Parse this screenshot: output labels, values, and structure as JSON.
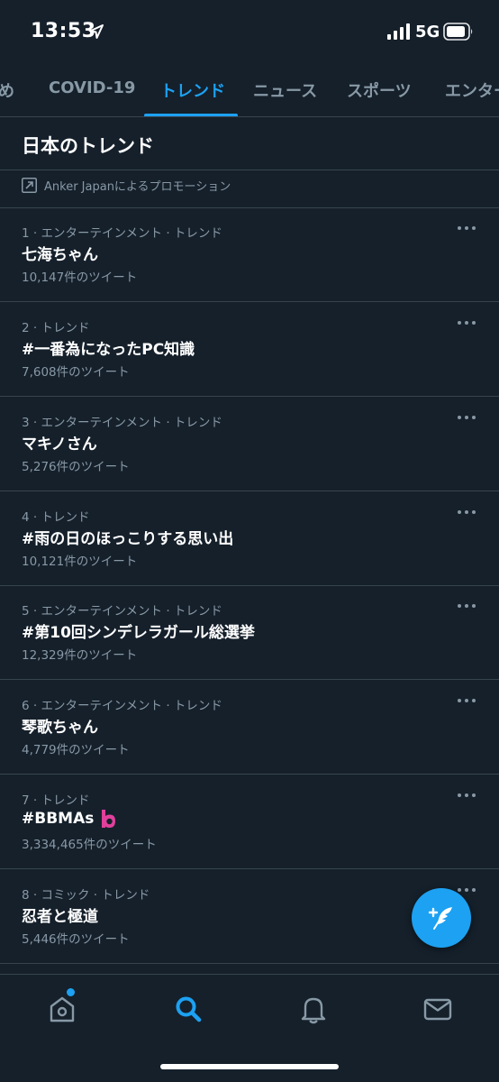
{
  "status_bar": {
    "time": "13:53",
    "network": "5G"
  },
  "tabs": [
    {
      "label": "め",
      "active": false
    },
    {
      "label": "COVID-19",
      "active": false
    },
    {
      "label": "トレンド",
      "active": true
    },
    {
      "label": "ニュース",
      "active": false
    },
    {
      "label": "スポーツ",
      "active": false
    },
    {
      "label": "エンター",
      "active": false
    }
  ],
  "section_title": "日本のトレンド",
  "promotion": {
    "text": "Anker Japanによるプロモーション"
  },
  "trends": [
    {
      "meta": "1 · エンターテインメント · トレンド",
      "name": "七海ちゃん",
      "count": "10,147件のツイート"
    },
    {
      "meta": "2 · トレンド",
      "name": "#一番為になったPC知識",
      "count": "7,608件のツイート"
    },
    {
      "meta": "3 · エンターテインメント · トレンド",
      "name": "マキノさん",
      "count": "5,276件のツイート"
    },
    {
      "meta": "4 · トレンド",
      "name": "#雨の日のほっこりする思い出",
      "count": "10,121件のツイート"
    },
    {
      "meta": "5 · エンターテインメント · トレンド",
      "name": "#第10回シンデレラガール総選挙",
      "count": "12,329件のツイート"
    },
    {
      "meta": "6 · エンターテインメント · トレンド",
      "name": "琴歌ちゃん",
      "count": "4,779件のツイート"
    },
    {
      "meta": "7 · トレンド",
      "name": "#BBMAs",
      "count": "3,334,465件のツイート"
    },
    {
      "meta": "8 · コミック · トレンド",
      "name": "忍者と極道",
      "count": "5,446件のツイート"
    }
  ],
  "bottom_nav": [
    {
      "icon": "home-icon",
      "active": false,
      "badge": true
    },
    {
      "icon": "search-icon",
      "active": true
    },
    {
      "icon": "bell-icon",
      "active": false
    },
    {
      "icon": "mail-icon",
      "active": false
    }
  ],
  "colors": {
    "background": "#15202b",
    "accent": "#1da1f2",
    "secondary_text": "#8899a6",
    "divider": "#38444d",
    "bbmas_pink": "#e0409b"
  }
}
